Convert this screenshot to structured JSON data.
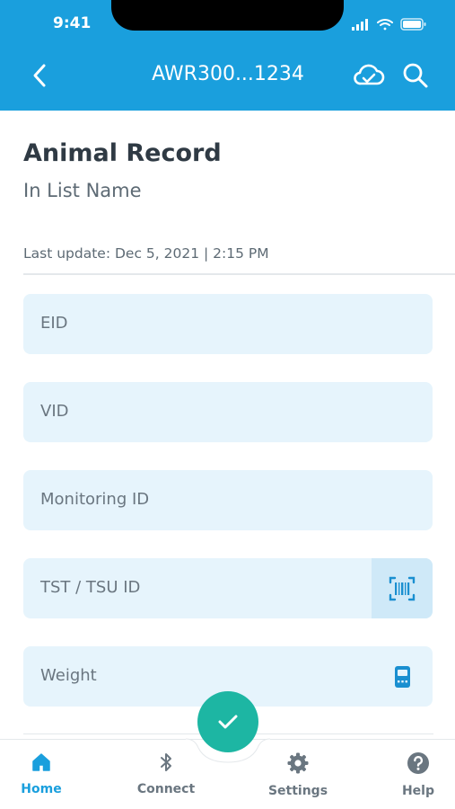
{
  "status_bar": {
    "time": "9:41"
  },
  "nav": {
    "title": "AWR300...1234",
    "back_icon": "chevron-left-icon",
    "sync_icon": "cloud-check-icon",
    "search_icon": "search-icon"
  },
  "record": {
    "title": "Animal Record",
    "subtitle": "In List Name",
    "last_update": "Last update: Dec 5, 2021 | 2:15 PM"
  },
  "fields": [
    {
      "label": "EID"
    },
    {
      "label": "VID"
    },
    {
      "label": "Monitoring ID"
    },
    {
      "label": "TST / TSU ID",
      "action_icon": "barcode-scan-icon"
    },
    {
      "label": "Weight",
      "action_icon": "scale-device-icon"
    }
  ],
  "fab": {
    "icon": "checkmark-icon"
  },
  "tabs": [
    {
      "label": "Home",
      "icon": "home-icon",
      "active": true
    },
    {
      "label": "Connect",
      "icon": "bluetooth-icon"
    },
    {
      "label": "Settings",
      "icon": "gear-icon"
    },
    {
      "label": "Help",
      "icon": "help-icon"
    }
  ],
  "colors": {
    "header": "#1a9fdd",
    "accent": "#1a9fdd",
    "fab": "#1db6a3",
    "field_bg": "#e6f4fc"
  }
}
